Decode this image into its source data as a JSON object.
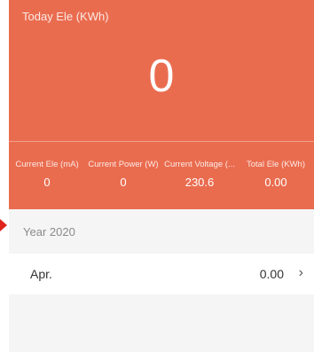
{
  "header": {
    "title": "Today Ele (KWh)",
    "value": "0"
  },
  "stats": [
    {
      "label": "Current Ele (mA)",
      "value": "0"
    },
    {
      "label": "Current Power (W)",
      "value": "0"
    },
    {
      "label": "Current Voltage (...",
      "value": "230.6"
    },
    {
      "label": "Total Ele (KWh)",
      "value": "0.00"
    }
  ],
  "history": {
    "year_label": "Year 2020",
    "months": [
      {
        "name": "Apr.",
        "value": "0.00"
      }
    ]
  },
  "icons": {
    "chevron": "chevron-right-icon"
  },
  "colors": {
    "accent": "#ea6c4f",
    "background": "#f5f5f5"
  }
}
